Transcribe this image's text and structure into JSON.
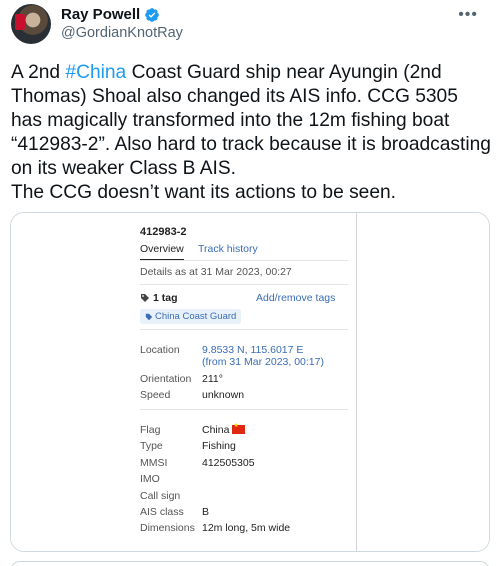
{
  "tweet": {
    "author": {
      "display_name": "Ray Powell",
      "handle": "@GordianKnotRay",
      "verified": true
    },
    "more_icon": "more-horizontal-icon",
    "text_parts": [
      "A 2nd ",
      "#China",
      " Coast Guard ship near Ayungin (2nd Thomas) Shoal also changed its AIS info. CCG 5305 has magically transformed into the 12m fishing boat “412983-2”. Also hard to track because it is broadcasting on its weaker Class B AIS.",
      "The CCG doesn’t want its actions to be seen."
    ],
    "colors": {
      "hashtag": "#1d9bf0",
      "verified": "#1d9bf0",
      "link": "#3a6db5"
    }
  },
  "ais": {
    "vessel_id": "412983-2",
    "tabs": [
      "Overview",
      "Track history"
    ],
    "details_time": "Details as at 31 Mar 2023, 00:27",
    "tag_count": "1 tag",
    "add_remove_tags": "Add/remove tags",
    "tag_chip": "China Coast Guard",
    "position": {
      "location_label": "Location",
      "location_value": "9.8533 N, 115.6017 E",
      "location_time": "(from 31 Mar 2023, 00:17)",
      "orientation_label": "Orientation",
      "orientation_value": "211°",
      "speed_label": "Speed",
      "speed_value": "unknown"
    },
    "details": [
      {
        "label": "Flag",
        "value": "China"
      },
      {
        "label": "Type",
        "value": "Fishing"
      },
      {
        "label": "MMSI",
        "value": "412505305"
      },
      {
        "label": "IMO",
        "value": ""
      },
      {
        "label": "Call sign",
        "value": ""
      },
      {
        "label": "AIS class",
        "value": "B"
      },
      {
        "label": "Dimensions",
        "value": "12m long, 5m wide"
      }
    ]
  }
}
